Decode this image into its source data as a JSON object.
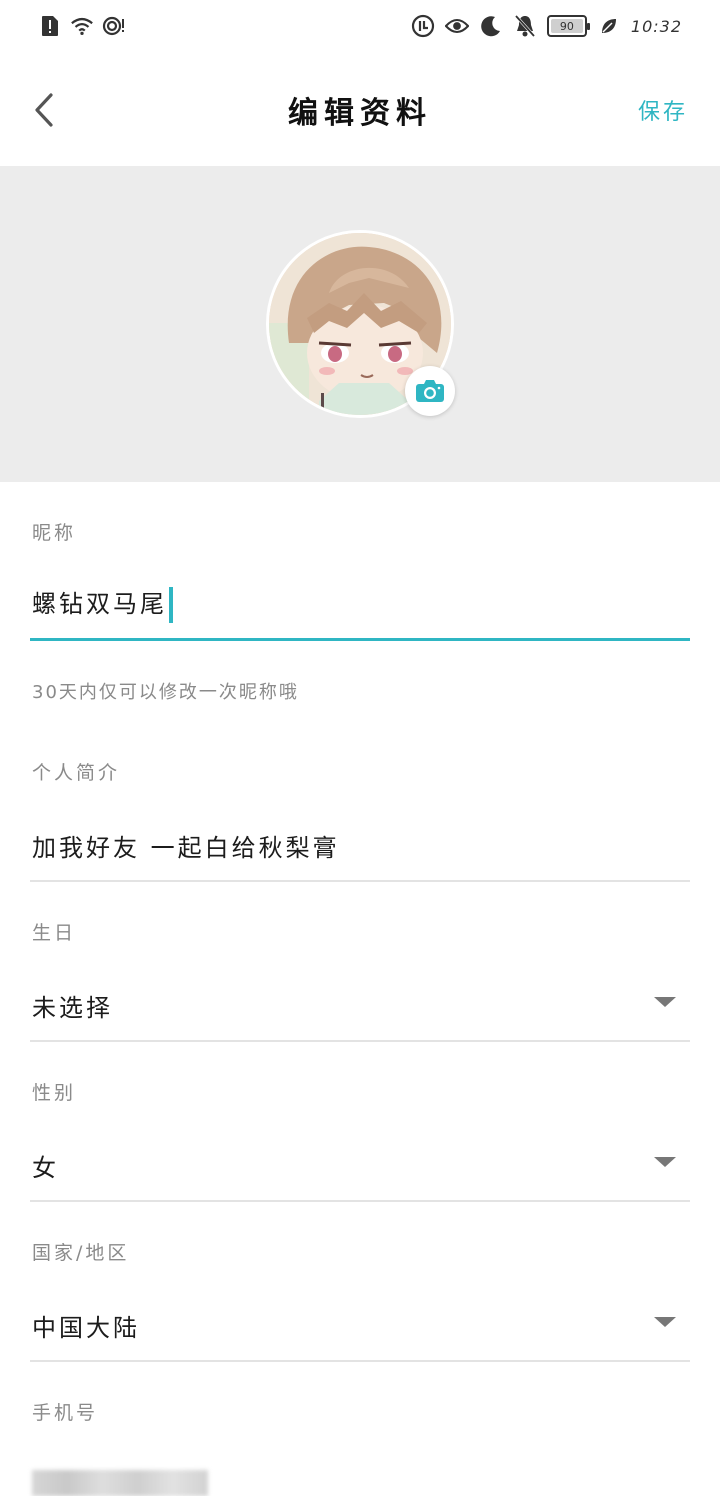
{
  "status_bar": {
    "battery_level": "90",
    "time": "10:32"
  },
  "header": {
    "title": "编辑资料",
    "save_label": "保存"
  },
  "colors": {
    "accent": "#2fb6c3",
    "avatar_bg": "#ececec"
  },
  "form": {
    "nickname": {
      "label": "昵称",
      "value": "螺钻双马尾",
      "hint": "30天内仅可以修改一次昵称哦"
    },
    "bio": {
      "label": "个人简介",
      "value": "加我好友 一起白给秋梨膏"
    },
    "birthday": {
      "label": "生日",
      "value": "未选择"
    },
    "gender": {
      "label": "性别",
      "value": "女"
    },
    "region": {
      "label": "国家/地区",
      "value": "中国大陆"
    },
    "phone": {
      "label": "手机号"
    }
  }
}
